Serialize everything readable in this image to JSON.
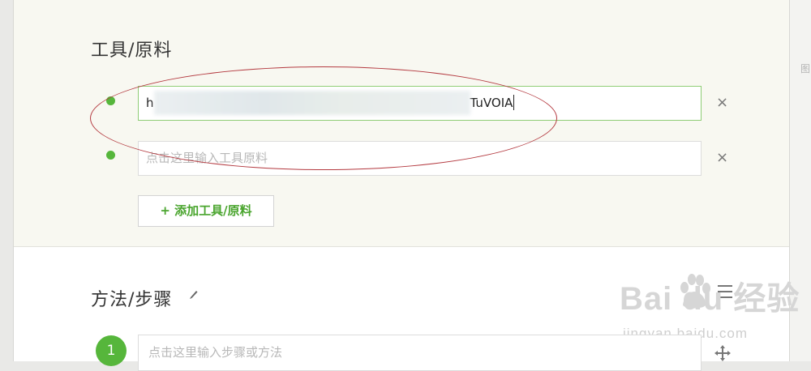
{
  "tools": {
    "title": "工具/原料",
    "items": [
      {
        "prefix": "h",
        "suffix": "TuVOIA",
        "placeholder": "",
        "remove": "×"
      },
      {
        "value": "",
        "placeholder": "点击这里输入工具原料",
        "remove": "×"
      }
    ],
    "add_label": "+ 添加工具/原料"
  },
  "steps": {
    "title": "方法/步骤",
    "step1_number": "1",
    "step1_placeholder": "点击这里输入步骤或方法"
  },
  "side": {
    "glyph": "图"
  },
  "watermark": {
    "main": "Bai du 经验",
    "sub": "jingyan.baidu.com"
  },
  "colors": {
    "accent": "#56b63b",
    "annotation": "#b43a40"
  }
}
